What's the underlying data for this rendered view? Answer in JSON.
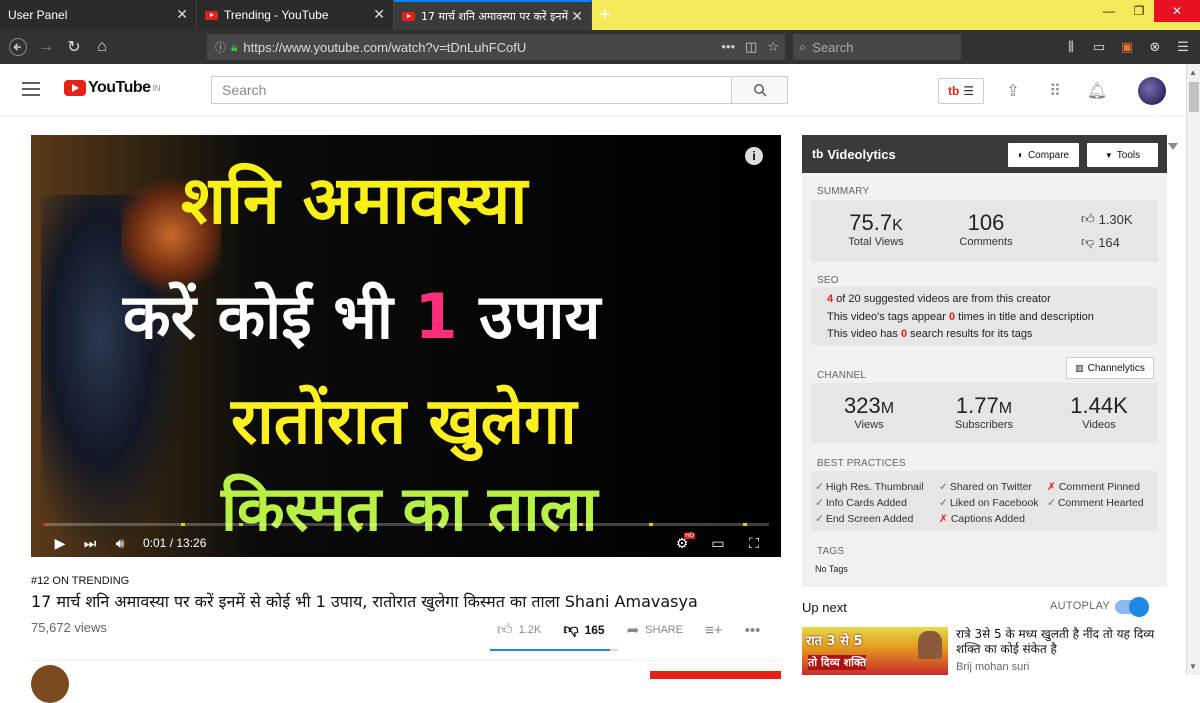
{
  "browser": {
    "tabs": [
      {
        "title": "User Panel"
      },
      {
        "title": "Trending - YouTube"
      },
      {
        "title": "17 मार्च शनि अमावस्या पर करें इनमें"
      }
    ],
    "url": "https://www.youtube.com/watch?v=tDnLuhFCofU",
    "search_placeholder": "Search"
  },
  "youtube": {
    "logo_text": "YouTube",
    "logo_region": "IN",
    "search_placeholder": "Search",
    "tb_label": "tb"
  },
  "video": {
    "overlay_lines": [
      "शनि अमावस्या",
      "करें कोई भी",
      "1",
      "उपाय",
      "रातोंरात खुलेगा",
      "किस्मत का ताला"
    ],
    "time": "0:01 / 13:26",
    "progress": 0.0012,
    "hd_badge": "HD"
  },
  "details": {
    "trending": "#12 ON TRENDING",
    "title": "17 मार्च शनि अमावस्या पर करें इनमें से कोई भी 1 उपाय, रातोरात खुलेगा किस्मत का ताला Shani Amavasya",
    "views": "75,672 views",
    "likes": "1.2K",
    "dislikes": "165",
    "share": "SHARE"
  },
  "videolytics": {
    "title": "Videolytics",
    "logo": "tb",
    "compare": "Compare",
    "tools": "Tools",
    "summary_label": "SUMMARY",
    "total_views": {
      "value": "75.7",
      "unit": "K",
      "label": "Total Views"
    },
    "comments": {
      "value": "106",
      "label": "Comments"
    },
    "likes": "1.30K",
    "dislikes": "164",
    "seo_label": "SEO",
    "seo": [
      {
        "pre": "",
        "hl": "4",
        "post": " of 20 suggested videos are from this creator"
      },
      {
        "pre": "This video's tags appear ",
        "hl": "0",
        "post": " times in title and description"
      },
      {
        "pre": "This video has ",
        "hl": "0",
        "post": " search results for its tags"
      }
    ],
    "channel_label": "CHANNEL",
    "channelytics": "Channelytics",
    "channel_views": {
      "value": "323",
      "unit": "M",
      "label": "Views"
    },
    "subscribers": {
      "value": "1.77",
      "unit": "M",
      "label": "Subscribers"
    },
    "videos": {
      "value": "1.44K",
      "label": "Videos"
    },
    "best_label": "BEST PRACTICES",
    "best_practices": [
      {
        "text": "High Res. Thumbnail",
        "ok": true
      },
      {
        "text": "Shared on Twitter",
        "ok": true
      },
      {
        "text": "Comment Pinned",
        "ok": false
      },
      {
        "text": "Info Cards Added",
        "ok": true
      },
      {
        "text": "Liked on Facebook",
        "ok": true
      },
      {
        "text": "Comment Hearted",
        "ok": true
      },
      {
        "text": "End Screen Added",
        "ok": true
      },
      {
        "text": "Captions Added",
        "ok": false
      }
    ],
    "tags_label": "TAGS",
    "tags_value": "No Tags"
  },
  "upnext": {
    "label": "Up next",
    "autoplay": "AUTOPLAY",
    "autoplay_on": true,
    "item": {
      "thumb_line1": "रात 3 से 5",
      "thumb_line2": "तो दिव्य शक्ति",
      "title": "रात्रे 3से 5 के मध्य खुलती है नींद तो यह दिव्य शक्ति का कोई संकेत है",
      "channel": "Brij mohan suri"
    }
  },
  "colors": {
    "brand": "#e62117",
    "accent": "#1e88e5",
    "tab_strip": "#f3e95a"
  }
}
